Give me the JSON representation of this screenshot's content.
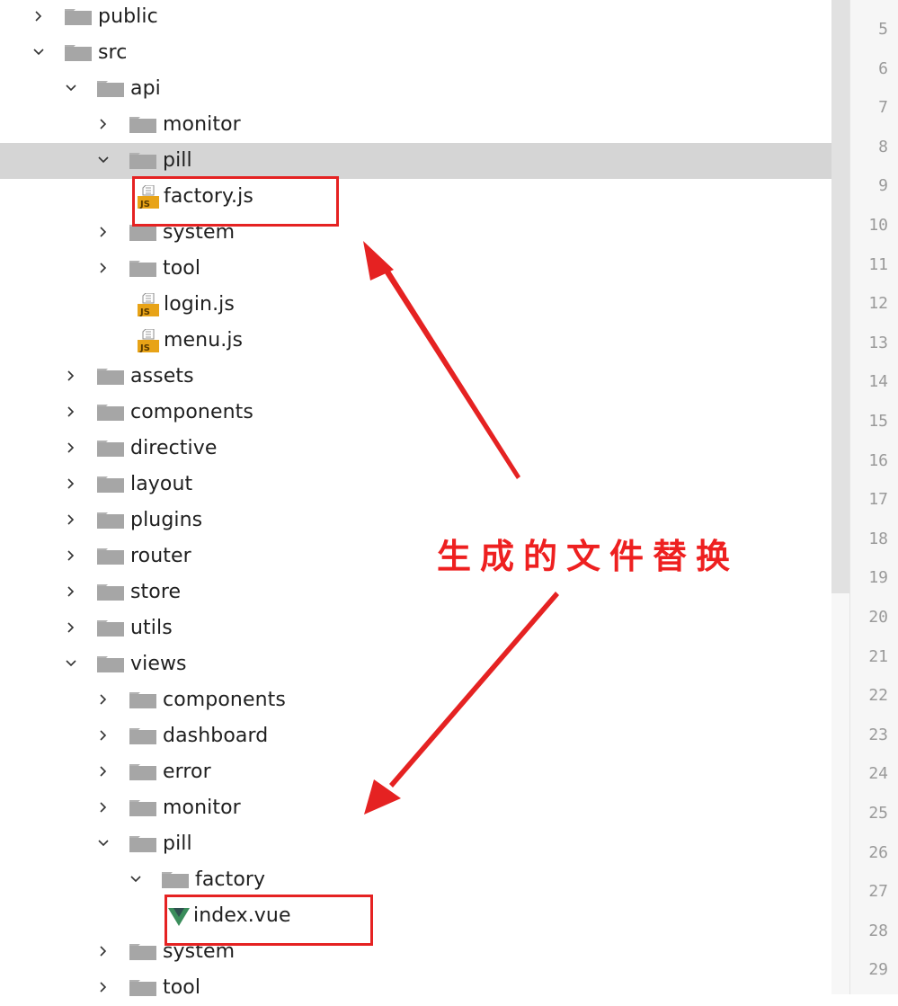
{
  "tree": [
    {
      "label": "public",
      "depth": 0,
      "kind": "folder",
      "state": "collapsed"
    },
    {
      "label": "src",
      "depth": 0,
      "kind": "folder",
      "state": "expanded"
    },
    {
      "label": "api",
      "depth": 1,
      "kind": "folder",
      "state": "expanded"
    },
    {
      "label": "monitor",
      "depth": 2,
      "kind": "folder",
      "state": "collapsed"
    },
    {
      "label": "pill",
      "depth": 2,
      "kind": "folder",
      "state": "expanded",
      "selected": true
    },
    {
      "label": "factory.js",
      "depth": 3,
      "kind": "js"
    },
    {
      "label": "system",
      "depth": 2,
      "kind": "folder",
      "state": "collapsed"
    },
    {
      "label": "tool",
      "depth": 2,
      "kind": "folder",
      "state": "collapsed"
    },
    {
      "label": "login.js",
      "depth": 3,
      "kind": "js"
    },
    {
      "label": "menu.js",
      "depth": 3,
      "kind": "js"
    },
    {
      "label": "assets",
      "depth": 1,
      "kind": "folder",
      "state": "collapsed"
    },
    {
      "label": "components",
      "depth": 1,
      "kind": "folder",
      "state": "collapsed"
    },
    {
      "label": "directive",
      "depth": 1,
      "kind": "folder",
      "state": "collapsed"
    },
    {
      "label": "layout",
      "depth": 1,
      "kind": "folder",
      "state": "collapsed"
    },
    {
      "label": "plugins",
      "depth": 1,
      "kind": "folder",
      "state": "collapsed"
    },
    {
      "label": "router",
      "depth": 1,
      "kind": "folder",
      "state": "collapsed"
    },
    {
      "label": "store",
      "depth": 1,
      "kind": "folder",
      "state": "collapsed"
    },
    {
      "label": "utils",
      "depth": 1,
      "kind": "folder",
      "state": "collapsed"
    },
    {
      "label": "views",
      "depth": 1,
      "kind": "folder",
      "state": "expanded"
    },
    {
      "label": "components",
      "depth": 2,
      "kind": "folder",
      "state": "collapsed"
    },
    {
      "label": "dashboard",
      "depth": 2,
      "kind": "folder",
      "state": "collapsed"
    },
    {
      "label": "error",
      "depth": 2,
      "kind": "folder",
      "state": "collapsed"
    },
    {
      "label": "monitor",
      "depth": 2,
      "kind": "folder",
      "state": "collapsed"
    },
    {
      "label": "pill",
      "depth": 2,
      "kind": "folder",
      "state": "expanded"
    },
    {
      "label": "factory",
      "depth": 3,
      "kind": "folder",
      "state": "expanded"
    },
    {
      "label": "index.vue",
      "depth": 4,
      "kind": "vue"
    },
    {
      "label": "system",
      "depth": 2,
      "kind": "folder",
      "state": "collapsed"
    },
    {
      "label": "tool",
      "depth": 2,
      "kind": "folder",
      "state": "collapsed"
    }
  ],
  "line_numbers": [
    "5",
    "6",
    "7",
    "8",
    "9",
    "10",
    "11",
    "12",
    "13",
    "14",
    "15",
    "16",
    "17",
    "18",
    "19",
    "20",
    "21",
    "22",
    "23",
    "24",
    "25",
    "26",
    "27",
    "28",
    "29"
  ],
  "annotation": {
    "text": "生成的文件替换",
    "color": "#ee2020"
  },
  "colors": {
    "selection": "#d5d5d5",
    "folder": "#a6a6a6",
    "js_badge": "#e8a317",
    "vue_green": "#3a8d5b",
    "highlight": "#e52222"
  },
  "icons": {
    "folder": "folder-icon",
    "js": "js-file-icon",
    "vue": "vue-file-icon",
    "expanded": "chevron-down-icon",
    "collapsed": "chevron-right-icon"
  }
}
